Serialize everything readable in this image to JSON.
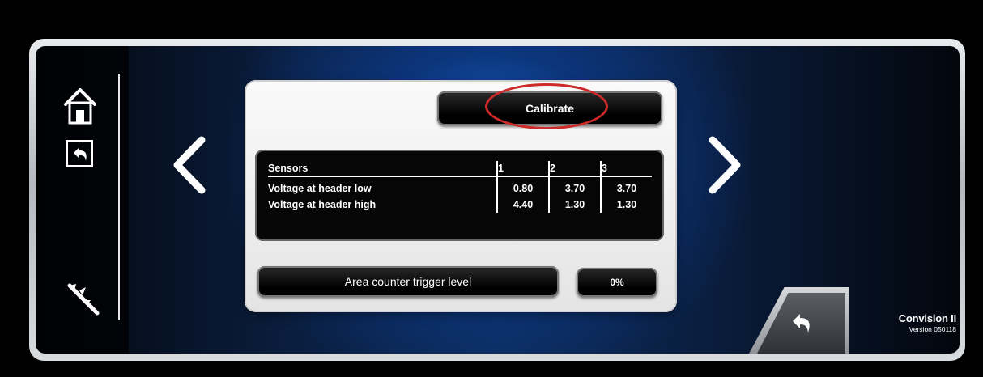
{
  "nav": {
    "home_icon": "home-icon",
    "back_icon": "back-arrow-icon",
    "tool_icon": "caliper-icon"
  },
  "panel": {
    "calibrate_label": "Calibrate",
    "table": {
      "header": [
        "Sensors",
        "1",
        "2",
        "3"
      ],
      "rows": [
        {
          "label": "Voltage at header low",
          "values": [
            "0.80",
            "3.70",
            "3.70"
          ]
        },
        {
          "label": "Voltage at header high",
          "values": [
            "4.40",
            "1.30",
            "1.30"
          ]
        }
      ]
    },
    "area_counter_label": "Area counter trigger level",
    "area_counter_value": "0%"
  },
  "footer": {
    "brand": "Convision II",
    "version": "Version 050118"
  },
  "colors": {
    "highlight": "#cf2a2a",
    "accent_blue": "#1969cd"
  }
}
